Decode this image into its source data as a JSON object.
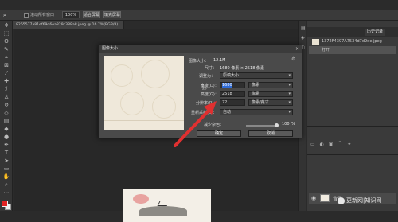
{
  "options_bar": {
    "scroll_all_windows": "滚动所有窗口",
    "zoom": "100%",
    "fit_screen": "适合屏幕",
    "fill_screen": "填充屏幕"
  },
  "document_tab": {
    "title": "8265577a81ef69d6ea829c388a8.jpeg @ 16.7%(RGB/8)"
  },
  "image_size_dialog": {
    "title": "图像大小",
    "image_size_label": "图像大小：",
    "image_size_value": "12.1M",
    "dimensions_label": "尺寸：",
    "dimensions_value": "1680 像素 × 2518 像素",
    "fit_to_label": "调整为：",
    "fit_to_value": "原稿大小",
    "width_label": "宽度(D)：",
    "width_value": "1680",
    "width_unit": "像素",
    "height_label": "高度(G)：",
    "height_value": "2518",
    "height_unit": "像素",
    "resolution_label": "分辨率(R)：",
    "resolution_value": "72",
    "resolution_unit": "像素/英寸",
    "resample_label": "重新采样(S)：",
    "resample_value": "自动",
    "reduce_noise_label": "减少杂色：",
    "reduce_noise_value": "100",
    "reduce_noise_unit": "%",
    "ok_button": "确定",
    "cancel_button": "取消"
  },
  "right_panel": {
    "tabs": [
      "历史记录"
    ],
    "history_items": [
      "1372F4397A7534d7d9de.jpeg",
      "打开"
    ],
    "layers": [
      {
        "name": "背景"
      }
    ]
  },
  "watermark": {
    "text": "更新网|知识网"
  },
  "colors": {
    "foreground": "#e02020",
    "background": "#eeeeee",
    "arrow": "#e03030"
  }
}
